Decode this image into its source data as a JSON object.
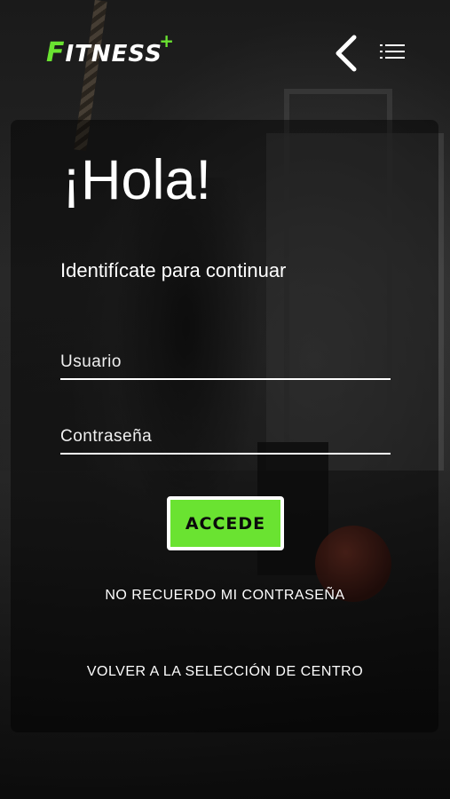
{
  "header": {
    "logo_text": "ITNESS",
    "logo_initial": "F",
    "logo_plus": "+",
    "back_icon": "chevron-left-icon",
    "menu_icon": "list-menu-icon"
  },
  "login": {
    "greeting": "¡Hola!",
    "subtitle": "Identifícate para continuar",
    "username_placeholder": "Usuario",
    "password_placeholder": "Contraseña",
    "submit_label": "ACCEDE",
    "forgot_password": "NO RECUERDO MI CONTRASEÑA",
    "back_to_center": "VOLVER A LA SELECCIÓN DE CENTRO"
  },
  "colors": {
    "accent": "#6ae331",
    "text": "#ffffff",
    "overlay": "rgba(0,0,0,0.45)"
  }
}
